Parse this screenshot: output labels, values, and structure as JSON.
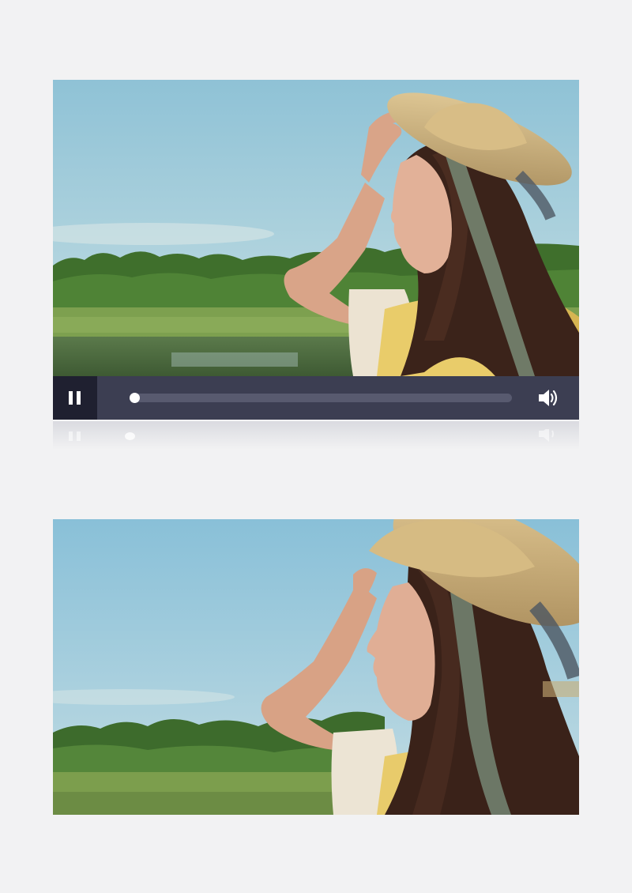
{
  "player": {
    "state": "playing",
    "play_toggle_icon": "pause-icon",
    "volume_icon": "volume-icon",
    "progress_fraction": 0.0
  },
  "frames": [
    {
      "icon": "video-frame",
      "description_icon": "woman-straw-hat-lake"
    },
    {
      "icon": "video-frame",
      "description_icon": "woman-straw-hat-closeup"
    }
  ],
  "colors": {
    "page_background": "#f2f2f3",
    "controls_bar": "#3c3e52",
    "play_button_bg": "#1f2030",
    "track": "#585a6f",
    "icon": "#ffffff"
  }
}
